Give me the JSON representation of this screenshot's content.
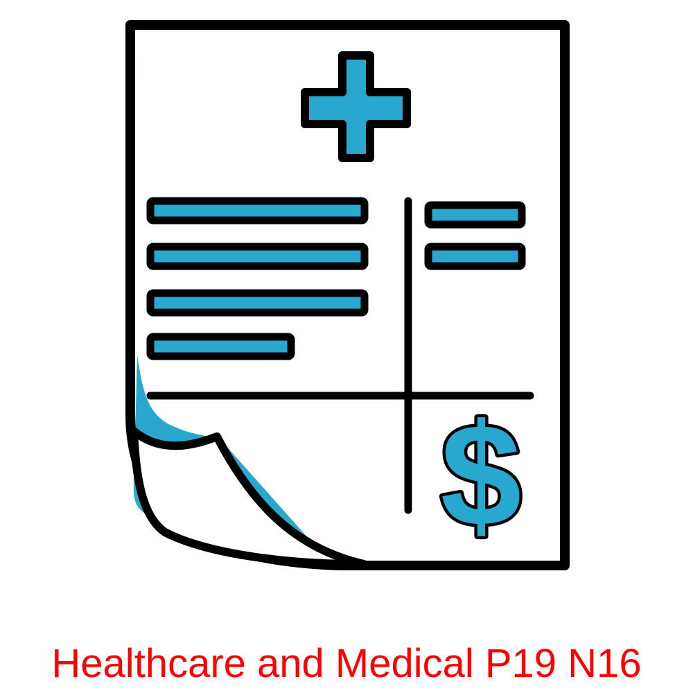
{
  "caption": {
    "text": "Healthcare and Medical P19 N16"
  },
  "colors": {
    "accent": "#29A8CF",
    "stroke": "#000000",
    "caption": "#FF0000",
    "background": "#FFFFFF"
  },
  "icons": {
    "main": "medical-bill-icon",
    "cross": "medical-cross-icon",
    "currency": "dollar-sign-icon"
  }
}
